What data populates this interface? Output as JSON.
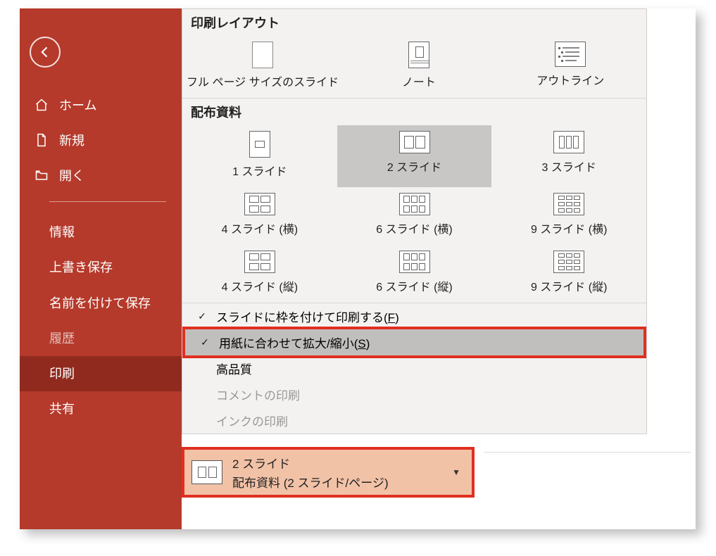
{
  "sidebar": {
    "items": [
      {
        "label": "ホーム"
      },
      {
        "label": "新規"
      },
      {
        "label": "開く"
      }
    ],
    "sub": [
      {
        "label": "情報"
      },
      {
        "label": "上書き保存"
      },
      {
        "label": "名前を付けて保存"
      },
      {
        "label": "履歴",
        "dim": true
      },
      {
        "label": "印刷",
        "active": true
      },
      {
        "label": "共有"
      }
    ]
  },
  "layout": {
    "section1": "印刷レイアウト",
    "row1": [
      {
        "label": "フル ページ サイズのスライド"
      },
      {
        "label": "ノート"
      },
      {
        "label": "アウトライン"
      }
    ],
    "section2": "配布資料",
    "row2": [
      {
        "label": "1 スライド"
      },
      {
        "label": "2 スライド",
        "highlight": true
      },
      {
        "label": "3 スライド"
      }
    ],
    "row3": [
      {
        "label": "4 スライド (横)"
      },
      {
        "label": "6 スライド (横)"
      },
      {
        "label": "9 スライド (横)"
      }
    ],
    "row4": [
      {
        "label": "4 スライド (縦)"
      },
      {
        "label": "6 スライド (縦)"
      },
      {
        "label": "9 スライド (縦)"
      }
    ]
  },
  "options": {
    "frame": {
      "pre": "スライドに枠を付けて印刷する(",
      "key": "F",
      "post": ")"
    },
    "scale": {
      "pre": "用紙に合わせて拡大/縮小(",
      "key": "S",
      "post": ")"
    },
    "hq": "高品質",
    "comments": "コメントの印刷",
    "ink": "インクの印刷"
  },
  "selector": {
    "title": "2 スライド",
    "sub": "配布資料 (2 スライド/ページ)"
  }
}
